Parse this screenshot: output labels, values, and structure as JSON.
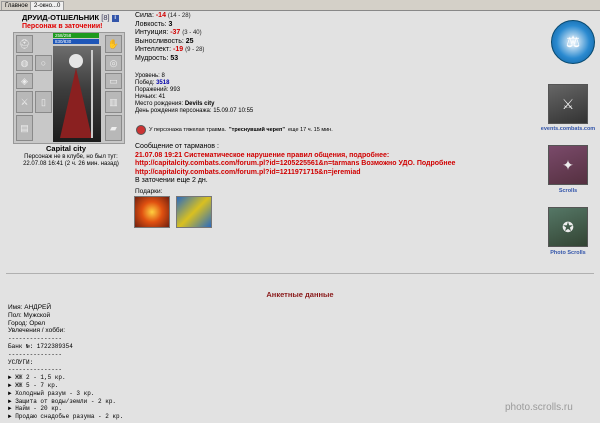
{
  "tabs": [
    {
      "label": "Главное"
    },
    {
      "label": "2-окно...0"
    }
  ],
  "character": {
    "name": "ДРУИД-ОТШЕЛЬНИК",
    "level": "[8]",
    "badge": "i",
    "status": "Персонаж в заточении!",
    "hp": "258/258",
    "mp": "830/830",
    "city": "Capital city",
    "club_line1": "Персонаж не в клубе, но был тут:",
    "club_line2": "22.07.08 16:41 (2 ч. 26 мин. назад)"
  },
  "stats": [
    {
      "label": "Сила:",
      "value": "-14",
      "range": "(14 - 28)",
      "neg": true
    },
    {
      "label": "Ловкость:",
      "value": "3",
      "range": "",
      "neg": false
    },
    {
      "label": "Интуиция:",
      "value": "-37",
      "range": "(3 - 40)",
      "neg": true
    },
    {
      "label": "Выносливость:",
      "value": "25",
      "range": "",
      "neg": false
    },
    {
      "label": "Интеллект:",
      "value": "-19",
      "range": "(9 - 28)",
      "neg": true
    },
    {
      "label": "Мудрость:",
      "value": "53",
      "range": "",
      "neg": false
    }
  ],
  "info": {
    "level_label": "Уровень:",
    "level_value": "8",
    "wins_label": "Побед:",
    "wins_value": "3518",
    "losses_label": "Поражений:",
    "losses_value": "993",
    "draws_label": "Ничьих:",
    "draws_value": "41",
    "birthplace_label": "Место рождения:",
    "birthplace_value": "Devils city",
    "birthday_label": "День рождения персонажа:",
    "birthday_value": "15.09.07 10:55"
  },
  "trauma": {
    "prefix": "У персонажа тяжелая травма.",
    "name": "\"треснувший череп\"",
    "suffix": "еще 17 ч. 15 мин."
  },
  "message": {
    "header": "Сообщение от тарманов :",
    "line1": "21.07.08 19:21 Систематическое нарушение правил общения, подробнее:",
    "line2": "http://capitalcity.combats.com/forum.pl?id=1205225561&n=tarmans Возможно УДО. Подробнее",
    "line3": "http://capitalcity.combats.com/forum.pl?id=1211971715&n=jeremiad",
    "jail_text": "В заточении еще 2 дн."
  },
  "gifts": {
    "label": "Подарки:"
  },
  "sidebar": {
    "captions": [
      "events.combats.com",
      "Scrolls",
      "Photo Scrolls"
    ]
  },
  "anket": {
    "title": "Анкетные данные",
    "lines": [
      "Имя: АНДРЕЙ",
      "Пол: Мужской",
      "Город: Орел",
      "Увлечения / хобби:"
    ],
    "mono_lines": [
      "---------------",
      "Банк №: 1722389354",
      "---------------",
      "УСЛУГИ:",
      "---------------",
      "► ЖЖ 2 - 1,5 кр.",
      "► ЖЖ 5 - 7 кр.",
      "► Холодный разум - 3 кр.",
      "► Защита от воды/земли - 2 кр.",
      "► Найм - 20 кр.",
      "► Продаю снадобье разума - 2 кр."
    ]
  },
  "watermark": "photo.scrolls.ru"
}
